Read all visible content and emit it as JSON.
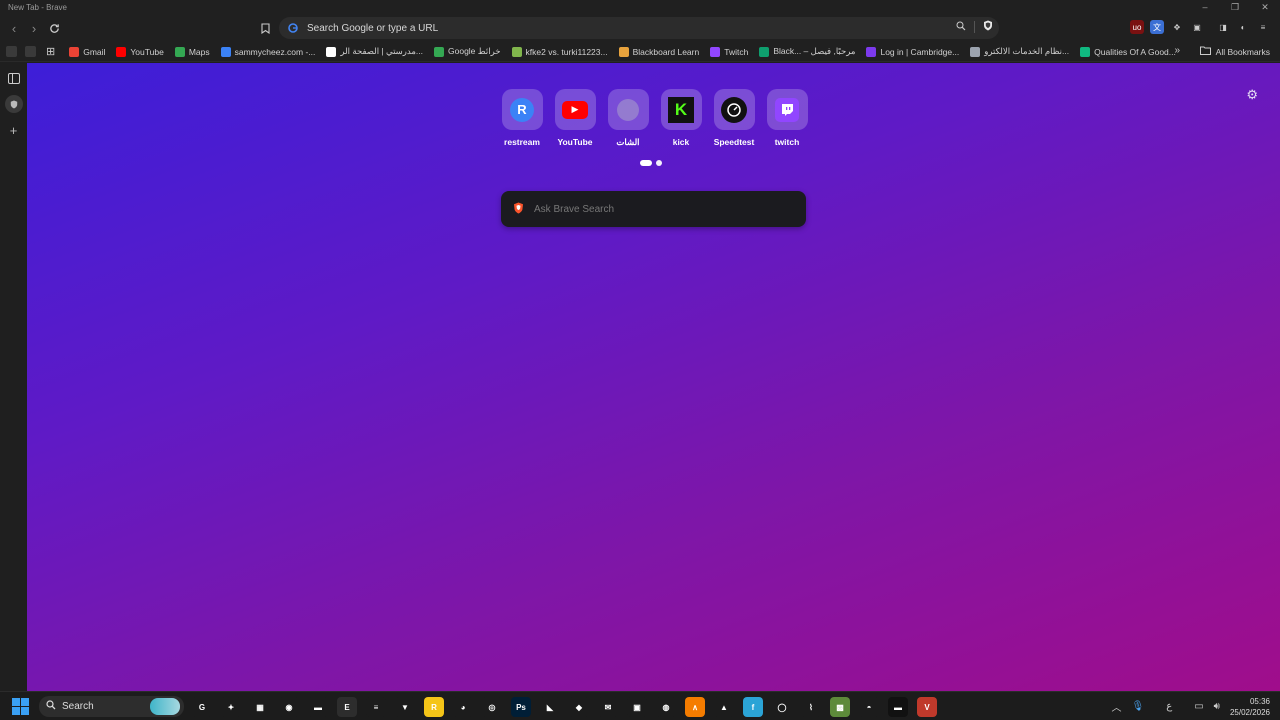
{
  "window": {
    "title": "New Tab - Brave",
    "controls": [
      "–",
      "❐",
      "✕"
    ]
  },
  "toolbar": {
    "omnibox_placeholder": "Search Google or type a URL"
  },
  "bookmarks": {
    "items": [
      {
        "label": "Gmail",
        "icon": "gmail-icon",
        "color": "#ea4335"
      },
      {
        "label": "YouTube",
        "icon": "youtube-icon",
        "color": "#ff0000"
      },
      {
        "label": "Maps",
        "icon": "maps-icon",
        "color": "#34a853"
      },
      {
        "label": "sammycheez.com -...",
        "icon": "site-icon",
        "color": "#3b82f6"
      },
      {
        "label": "مدرستي | الصفحة الر...",
        "icon": "madrasati-icon",
        "color": "#ffffff"
      },
      {
        "label": "Google خرائط",
        "icon": "maps-icon",
        "color": "#34a853"
      },
      {
        "label": "kfke2 vs. turki11223...",
        "icon": "chess-icon",
        "color": "#81b64c"
      },
      {
        "label": "Blackboard Learn",
        "icon": "blackboard-icon",
        "color": "#e8a33d"
      },
      {
        "label": "Twitch",
        "icon": "twitch-icon",
        "color": "#9146ff"
      },
      {
        "label": "Black... – مرحبًا, فيصل",
        "icon": "blackboard-icon",
        "color": "#0e9f6e"
      },
      {
        "label": "Log in | Cambridge...",
        "icon": "cambridge-icon",
        "color": "#7c3aed"
      },
      {
        "label": "نظام الخدمات الالكترو...",
        "icon": "globe-icon",
        "color": "#9ca3af"
      },
      {
        "label": "Qualities Of A Good...",
        "icon": "site-icon",
        "color": "#10b981"
      }
    ],
    "all_label": "All Bookmarks"
  },
  "tiles": [
    {
      "label": "restream",
      "icon": "restream-icon",
      "glyph": "R"
    },
    {
      "label": "YouTube",
      "icon": "youtube-icon",
      "glyph": "▶"
    },
    {
      "label": "الشات",
      "icon": "globe-icon",
      "glyph": ""
    },
    {
      "label": "kick",
      "icon": "kick-icon",
      "glyph": "K"
    },
    {
      "label": "Speedtest",
      "icon": "speedtest-icon",
      "glyph": ""
    },
    {
      "label": "twitch",
      "icon": "twitch-icon",
      "glyph": ""
    }
  ],
  "search": {
    "placeholder": "Ask Brave Search"
  },
  "taskbar": {
    "search_label": "Search",
    "apps": [
      {
        "name": "g-hub-icon",
        "glyph": "G",
        "bg": "#1c1c1c"
      },
      {
        "name": "dots-app-icon",
        "glyph": "✦",
        "bg": "#1c1c1c"
      },
      {
        "name": "store-icon",
        "glyph": "▦",
        "bg": "#1c1c1c"
      },
      {
        "name": "chrome-icon",
        "glyph": "◉",
        "bg": "#1c1c1c"
      },
      {
        "name": "explorer-icon",
        "glyph": "▬",
        "bg": "#1c1c1c"
      },
      {
        "name": "epic-icon",
        "glyph": "E",
        "bg": "#2d2d2d"
      },
      {
        "name": "notepad-icon",
        "glyph": "≡",
        "bg": "#1c1c1c"
      },
      {
        "name": "brave-icon",
        "glyph": "▼",
        "bg": "#1c1c1c"
      },
      {
        "name": "rockstar-icon",
        "glyph": "R",
        "bg": "#f5c518"
      },
      {
        "name": "discord-icon",
        "glyph": "◕",
        "bg": "#1c1c1c"
      },
      {
        "name": "obs-icon",
        "glyph": "◎",
        "bg": "#1c1c1c"
      },
      {
        "name": "photoshop-icon",
        "glyph": "Ps",
        "bg": "#001e36"
      },
      {
        "name": "nvidia-icon",
        "glyph": "◣",
        "bg": "#1c1c1c"
      },
      {
        "name": "app-icon",
        "glyph": "◆",
        "bg": "#1c1c1c"
      },
      {
        "name": "mail-icon",
        "glyph": "✉",
        "bg": "#1c1c1c"
      },
      {
        "name": "app-icon",
        "glyph": "▣",
        "bg": "#1c1c1c"
      },
      {
        "name": "globe-icon",
        "glyph": "◍",
        "bg": "#1c1c1c"
      },
      {
        "name": "app-icon",
        "glyph": "∧",
        "bg": "#f57c00"
      },
      {
        "name": "app-icon",
        "glyph": "▲",
        "bg": "#1c1c1c"
      },
      {
        "name": "app-icon",
        "glyph": "f",
        "bg": "#2ba4d6"
      },
      {
        "name": "whatsapp-icon",
        "glyph": "◯",
        "bg": "#1c1c1c"
      },
      {
        "name": "app-icon",
        "glyph": "⌇",
        "bg": "#1c1c1c"
      },
      {
        "name": "minecraft-icon",
        "glyph": "▩",
        "bg": "#5d8a3a"
      },
      {
        "name": "steam-icon",
        "glyph": "◓",
        "bg": "#1c1c1c"
      },
      {
        "name": "app-icon",
        "glyph": "▬",
        "bg": "#111111"
      },
      {
        "name": "voicemod-icon",
        "glyph": "V",
        "bg": "#c0392b"
      }
    ],
    "tray": {
      "lang": "ع",
      "time": "05:36",
      "date": "25/02/2026"
    }
  }
}
